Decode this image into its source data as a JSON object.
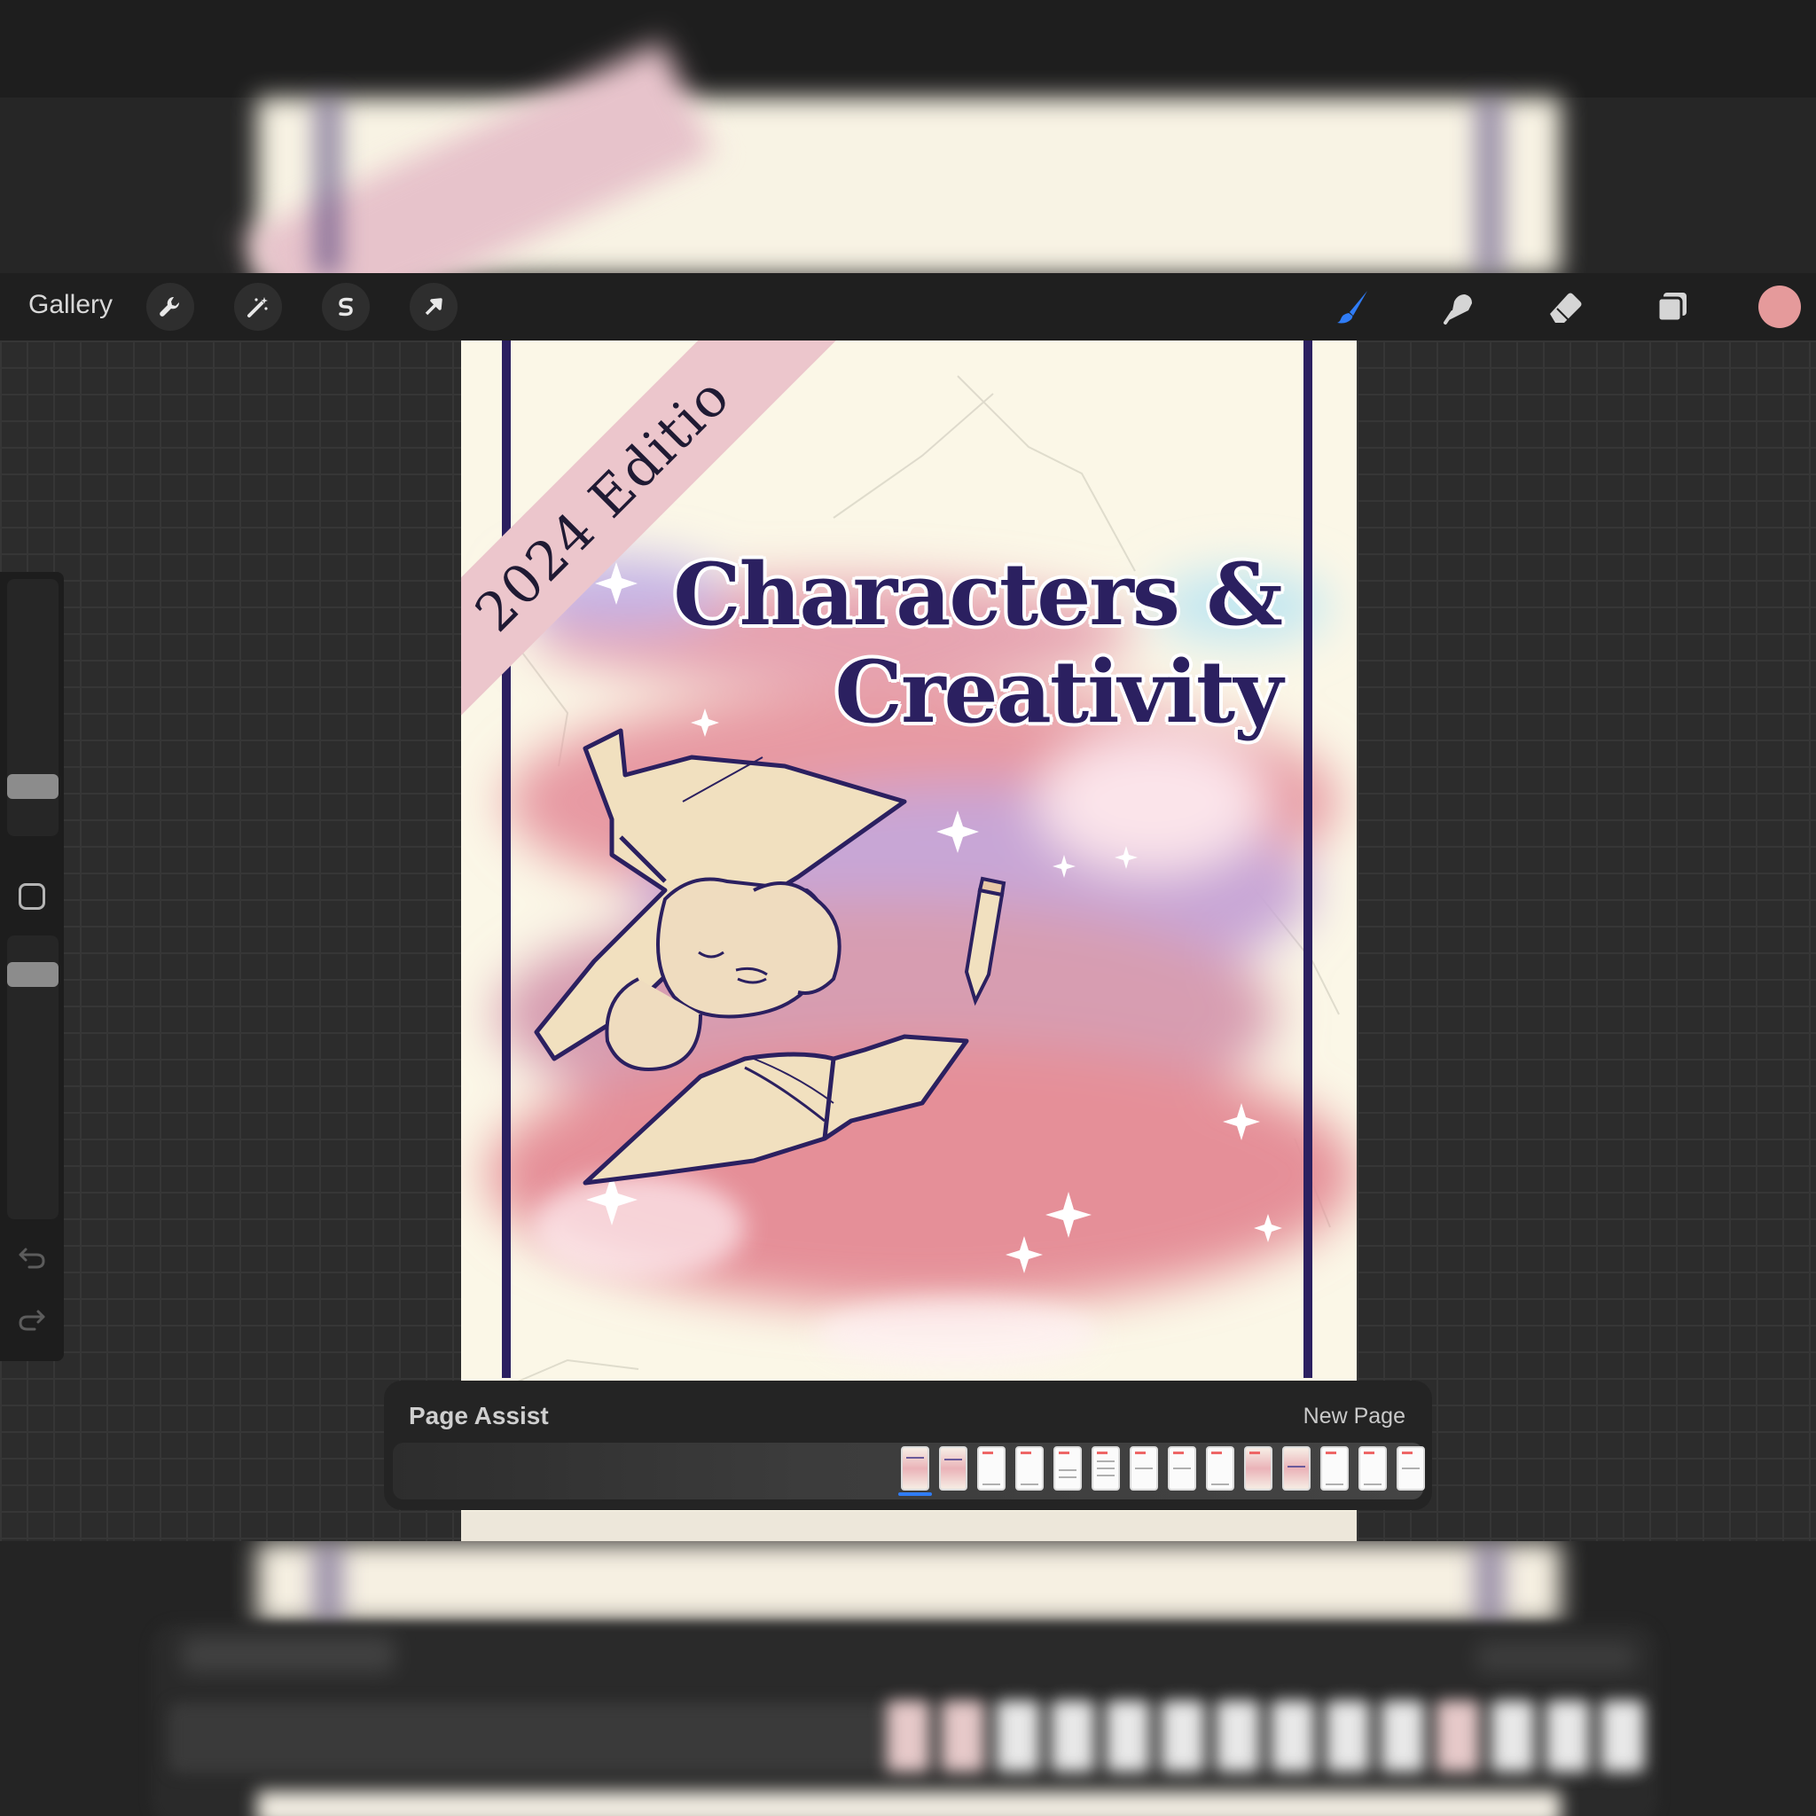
{
  "toolbar": {
    "gallery_label": "Gallery",
    "left_tools": [
      "wrench-icon",
      "magic-wand-icon",
      "selection-icon",
      "transform-arrow-icon"
    ],
    "right_tools": [
      "brush-icon",
      "smudge-icon",
      "eraser-icon",
      "layers-icon"
    ],
    "current_color": "#e59a9b",
    "accent_color": "#2f7cf6"
  },
  "sidebar": {
    "brush_size_level": 0.2,
    "opacity_level": 0.85,
    "items": [
      "modify-button",
      "undo-icon",
      "redo-icon"
    ]
  },
  "artwork": {
    "ribbon_text": "2024 Editio",
    "title_line1": "Characters &",
    "title_line2": "Creativity"
  },
  "page_assist": {
    "title": "Page Assist",
    "new_page_label": "New Page",
    "page_count": 14,
    "selected_page": 1
  }
}
